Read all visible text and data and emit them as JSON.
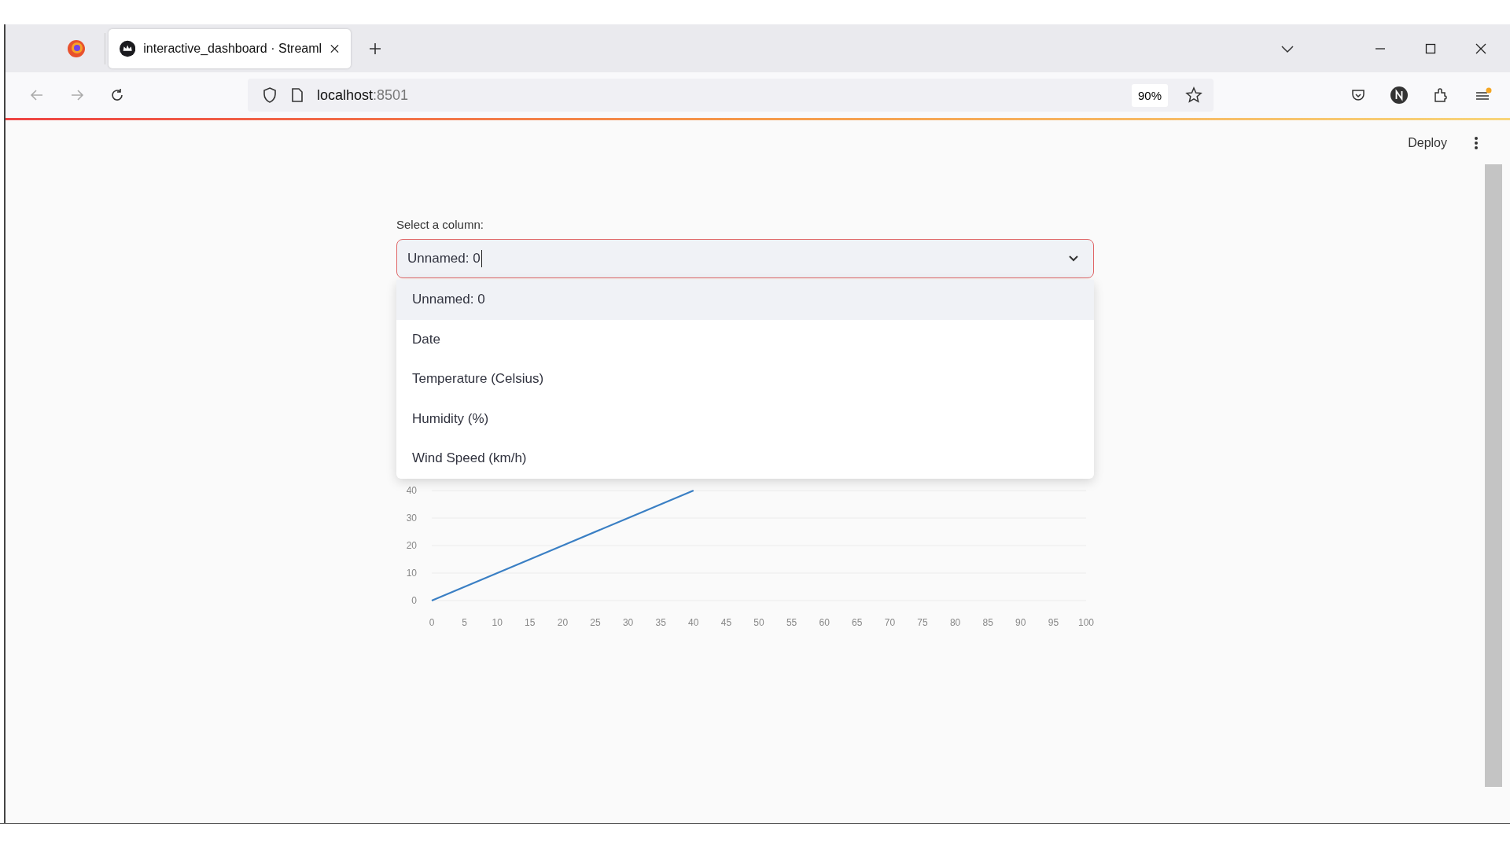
{
  "browser": {
    "tabs": [
      {
        "title": "interactive_dashboard · Streaml",
        "selected": true
      }
    ],
    "url": {
      "host": "localhost",
      "port": ":8501"
    },
    "zoom": "90%"
  },
  "header": {
    "deploy": "Deploy"
  },
  "select": {
    "label": "Select a column:",
    "value": "Unnamed: 0",
    "expanded": true,
    "options": [
      {
        "label": "Unnamed: 0",
        "selected": true
      },
      {
        "label": "Date",
        "selected": false
      },
      {
        "label": "Temperature (Celsius)",
        "selected": false
      },
      {
        "label": "Humidity (%)",
        "selected": false
      },
      {
        "label": "Wind Speed (km/h)",
        "selected": false
      }
    ]
  },
  "chart": {
    "chart_data": {
      "type": "line",
      "x": [
        0,
        10,
        20,
        30,
        40
      ],
      "series": [
        {
          "color": "#3a7fc4",
          "values": [
            0,
            10,
            20,
            30,
            40
          ]
        }
      ],
      "xlim": [
        0,
        100
      ],
      "ylim": [
        0,
        40
      ],
      "grid": true,
      "xticks": [
        0,
        5,
        10,
        15,
        20,
        25,
        30,
        35,
        40,
        45,
        50,
        55,
        60,
        65,
        70,
        75,
        80,
        85,
        90,
        95,
        100
      ],
      "yticks": [
        0,
        10,
        20,
        30,
        40
      ]
    }
  }
}
